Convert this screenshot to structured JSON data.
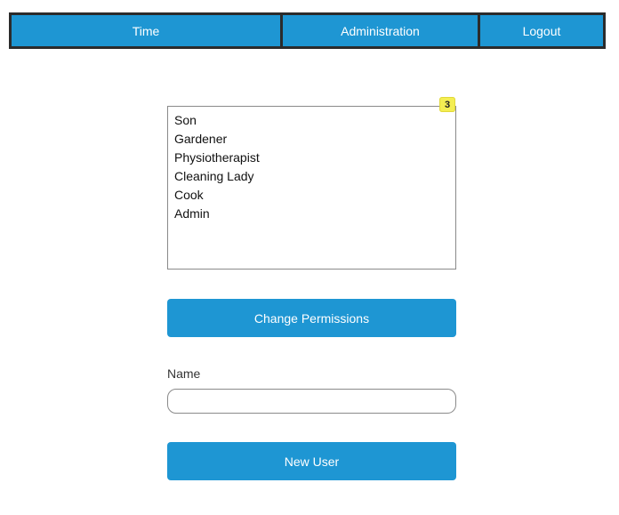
{
  "nav": {
    "items": [
      {
        "label": "Time"
      },
      {
        "label": "Administration"
      },
      {
        "label": "Logout"
      }
    ]
  },
  "roles": {
    "badge_count": "3",
    "items": [
      {
        "label": "Son"
      },
      {
        "label": "Gardener"
      },
      {
        "label": "Physiotherapist"
      },
      {
        "label": "Cleaning Lady"
      },
      {
        "label": "Cook"
      },
      {
        "label": "Admin"
      }
    ]
  },
  "actions": {
    "change_permissions_label": "Change Permissions",
    "new_user_label": "New User"
  },
  "form": {
    "name_label": "Name",
    "name_value": "",
    "name_placeholder": ""
  },
  "colors": {
    "accent": "#1e96d3",
    "nav_border": "#2b2b2b",
    "badge": "#f4ee52"
  }
}
